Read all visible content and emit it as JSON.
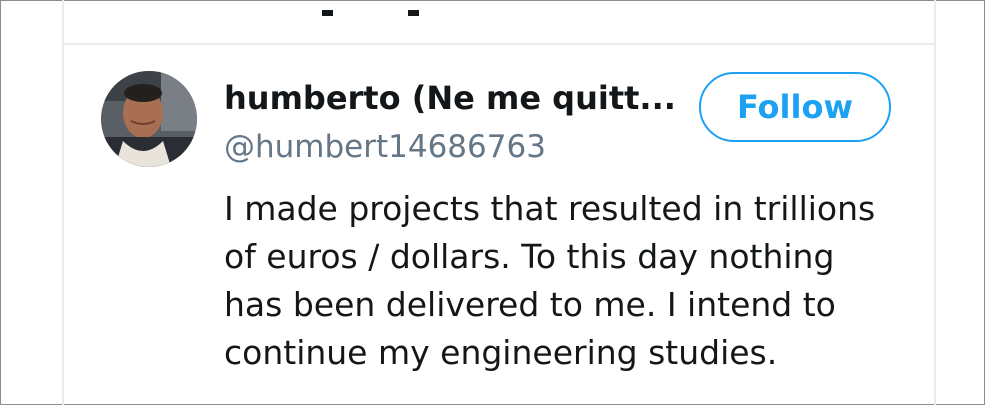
{
  "user": {
    "display_name": "humberto (Ne me quitt...",
    "handle": "@humbert14686763"
  },
  "follow_button": {
    "label": "Follow"
  },
  "tweet": {
    "lines": [
      "I made projects that resulted in trillions",
      "of euros / dollars. To this day nothing",
      "has been delivered to me. I intend to",
      "continue my engineering studies."
    ]
  },
  "colors": {
    "accent": "#1da1f2",
    "text_primary": "#14171a",
    "text_secondary": "#657786",
    "border": "#e6ecf0"
  }
}
